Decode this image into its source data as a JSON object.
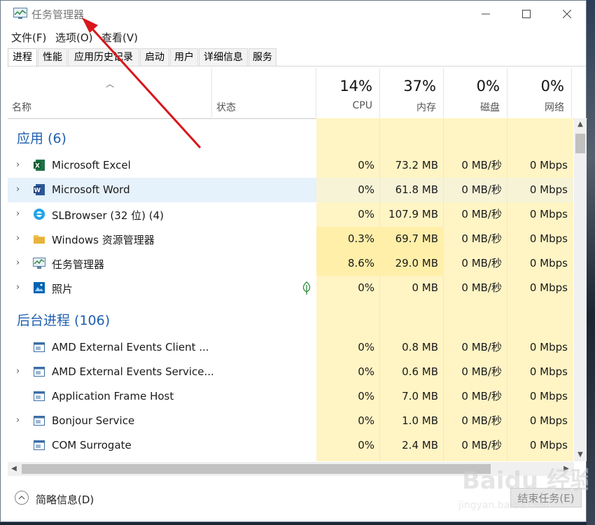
{
  "window": {
    "title": "任务管理器"
  },
  "menu": [
    "文件(F)",
    "选项(O)",
    "查看(V)"
  ],
  "tabs": [
    "进程",
    "性能",
    "应用历史记录",
    "启动",
    "用户",
    "详细信息",
    "服务"
  ],
  "columns": {
    "name": "名称",
    "status": "状态",
    "cpu": {
      "pct": "14%",
      "label": "CPU"
    },
    "mem": {
      "pct": "37%",
      "label": "内存"
    },
    "disk": {
      "pct": "0%",
      "label": "磁盘"
    },
    "net": {
      "pct": "0%",
      "label": "网络"
    }
  },
  "groups": {
    "apps": "应用 (6)",
    "background": "后台进程 (106)"
  },
  "apps": [
    {
      "name": "Microsoft Excel",
      "icon": "excel-icon",
      "cpu": "0%",
      "mem": "73.2 MB",
      "disk": "0 MB/秒",
      "net": "0 Mbps",
      "expandable": true
    },
    {
      "name": "Microsoft Word",
      "icon": "word-icon",
      "cpu": "0%",
      "mem": "61.8 MB",
      "disk": "0 MB/秒",
      "net": "0 Mbps",
      "expandable": true,
      "selected": true
    },
    {
      "name": "SLBrowser (32 位) (4)",
      "icon": "browser-icon",
      "cpu": "0%",
      "mem": "107.9 MB",
      "disk": "0 MB/秒",
      "net": "0 Mbps",
      "expandable": true
    },
    {
      "name": "Windows 资源管理器",
      "icon": "folder-icon",
      "cpu": "0.3%",
      "mem": "69.7 MB",
      "disk": "0 MB/秒",
      "net": "0 Mbps",
      "expandable": true
    },
    {
      "name": "任务管理器",
      "icon": "taskmgr-icon",
      "cpu": "8.6%",
      "mem": "29.0 MB",
      "disk": "0 MB/秒",
      "net": "0 Mbps",
      "expandable": true
    },
    {
      "name": "照片",
      "icon": "photos-icon",
      "cpu": "0%",
      "mem": "0 MB",
      "disk": "0 MB/秒",
      "net": "0 Mbps",
      "expandable": true,
      "suspended": true
    }
  ],
  "background": [
    {
      "name": "AMD External Events Client ...",
      "icon": "service-icon",
      "cpu": "0%",
      "mem": "0.8 MB",
      "disk": "0 MB/秒",
      "net": "0 Mbps",
      "expandable": false
    },
    {
      "name": "AMD External Events Service...",
      "icon": "service-icon",
      "cpu": "0%",
      "mem": "0.6 MB",
      "disk": "0 MB/秒",
      "net": "0 Mbps",
      "expandable": true
    },
    {
      "name": "Application Frame Host",
      "icon": "service-icon",
      "cpu": "0%",
      "mem": "7.0 MB",
      "disk": "0 MB/秒",
      "net": "0 Mbps",
      "expandable": false
    },
    {
      "name": "Bonjour Service",
      "icon": "service-icon",
      "cpu": "0%",
      "mem": "1.0 MB",
      "disk": "0 MB/秒",
      "net": "0 Mbps",
      "expandable": true
    },
    {
      "name": "COM Surrogate",
      "icon": "service-icon",
      "cpu": "0%",
      "mem": "2.4 MB",
      "disk": "0 MB/秒",
      "net": "0 Mbps",
      "expandable": false
    }
  ],
  "footer": {
    "fewer": "简略信息(D)",
    "end_task": "结束任务(E)"
  },
  "watermark": {
    "brand": "Baidu 经验",
    "url": "jingyan.baidu.com"
  },
  "colors": {
    "accent": "#1f5fb0",
    "heat_low": "#fff4c4",
    "heat_mid": "#ffefa9",
    "arrow": "#d8161b",
    "selection": "#e5f1fb"
  }
}
